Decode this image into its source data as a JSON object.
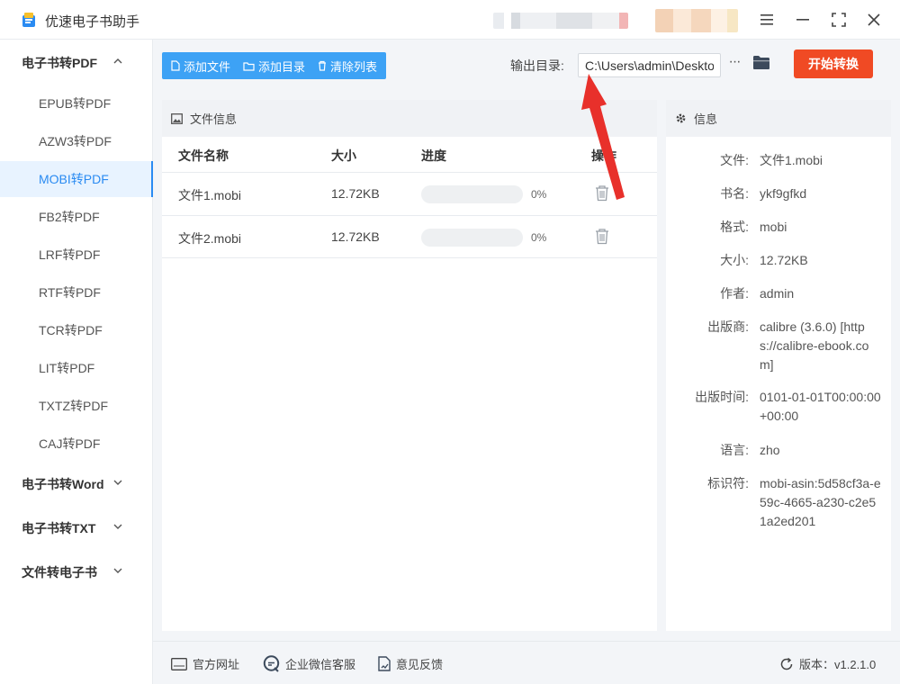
{
  "app": {
    "title": "优速电子书助手",
    "window_controls": [
      "menu-icon",
      "minimize-icon",
      "maximize-icon",
      "close-icon"
    ]
  },
  "sidebar": {
    "groups": [
      {
        "label": "电子书转PDF",
        "expanded": true
      },
      {
        "label": "电子书转Word",
        "expanded": false
      },
      {
        "label": "电子书转TXT",
        "expanded": false
      },
      {
        "label": "文件转电子书",
        "expanded": false
      }
    ],
    "items": [
      {
        "label": "EPUB转PDF"
      },
      {
        "label": "AZW3转PDF"
      },
      {
        "label": "MOBI转PDF",
        "active": true
      },
      {
        "label": "FB2转PDF"
      },
      {
        "label": "LRF转PDF"
      },
      {
        "label": "RTF转PDF"
      },
      {
        "label": "TCR转PDF"
      },
      {
        "label": "LIT转PDF"
      },
      {
        "label": "TXTZ转PDF"
      },
      {
        "label": "CAJ转PDF"
      }
    ]
  },
  "toolbar": {
    "add_file": "添加文件",
    "add_folder": "添加目录",
    "clear_list": "清除列表",
    "output_label": "输出目录:",
    "output_path": "C:\\Users\\admin\\Deskto",
    "more": "···",
    "start": "开始转换"
  },
  "file_panel": {
    "title": "文件信息",
    "columns": [
      "文件名称",
      "大小",
      "进度",
      "操作"
    ],
    "rows": [
      {
        "name": "文件1.mobi",
        "size": "12.72KB",
        "progress": 0,
        "progress_text": "0%"
      },
      {
        "name": "文件2.mobi",
        "size": "12.72KB",
        "progress": 0,
        "progress_text": "0%"
      }
    ]
  },
  "info_panel": {
    "title": "信息",
    "fields": [
      {
        "key": "文件:",
        "value": "文件1.mobi"
      },
      {
        "key": "书名:",
        "value": "ykf9gfkd"
      },
      {
        "key": "格式:",
        "value": "mobi"
      },
      {
        "key": "大小:",
        "value": "12.72KB"
      },
      {
        "key": "作者:",
        "value": "admin"
      },
      {
        "key": "出版商:",
        "value": "calibre (3.6.0) [https://calibre-ebook.com]"
      },
      {
        "key": "出版时间:",
        "value": "0101-01-01T00:00:00+00:00"
      },
      {
        "key": "语言:",
        "value": "zho"
      },
      {
        "key": "标识符:",
        "value": "mobi-asin:5d58cf3a-e59c-4665-a230-c2e51a2ed201"
      }
    ]
  },
  "footer": {
    "website": "官方网址",
    "wechat": "企业微信客服",
    "feedback": "意见反馈",
    "version": "版本：v1.2.1.0"
  },
  "colors": {
    "accent": "#3da2f5",
    "active_text": "#2a8bf2",
    "start_button": "#f04a24",
    "annotation_arrow": "#e8302b"
  }
}
